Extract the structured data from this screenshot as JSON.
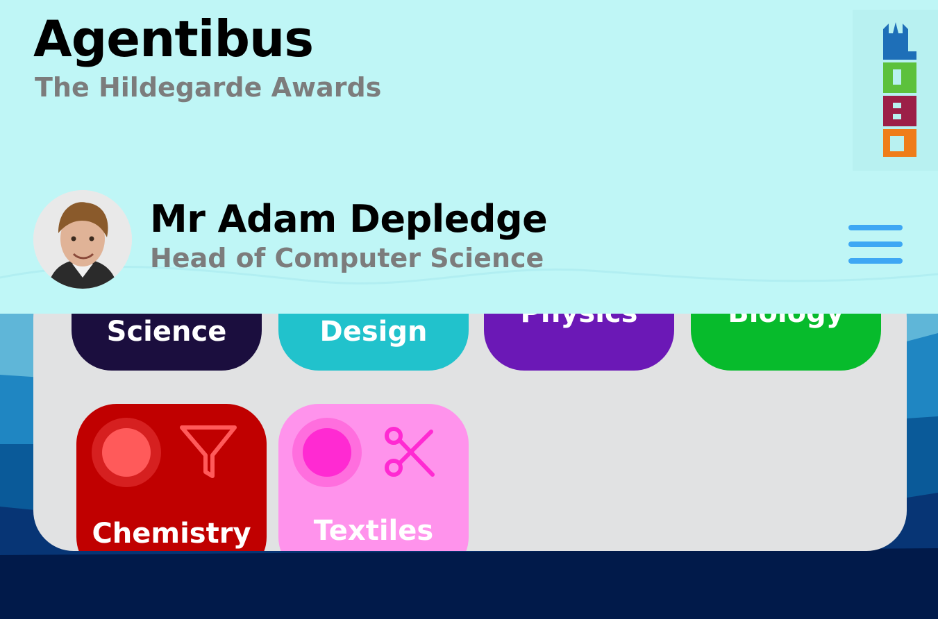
{
  "header": {
    "title": "Agentibus",
    "subtitle": "The Hildegarde Awards",
    "logo_icon": "castle-logo-icon"
  },
  "profile": {
    "name": "Mr Adam Depledge",
    "role": "Head of Computer Science",
    "avatar_icon": "user-avatar-photo"
  },
  "menu": {
    "icon": "hamburger-menu-icon"
  },
  "subjects": [
    {
      "label": "Science",
      "color": "#1b0e3e"
    },
    {
      "label": "Design",
      "color": "#21c2cc"
    },
    {
      "label": "Physics",
      "color": "#6b18b6"
    },
    {
      "label": "Biology",
      "color": "#07bb2c"
    },
    {
      "label": "Chemistry",
      "color": "#c00000",
      "icon": "flask-funnel-icon"
    },
    {
      "label": "Textiles",
      "color": "#ff93ec",
      "icon": "scissors-icon"
    }
  ],
  "colors": {
    "header_bg": "#bff6f6",
    "accent": "#3ea7f4",
    "panel_bg": "#e1e2e3"
  }
}
